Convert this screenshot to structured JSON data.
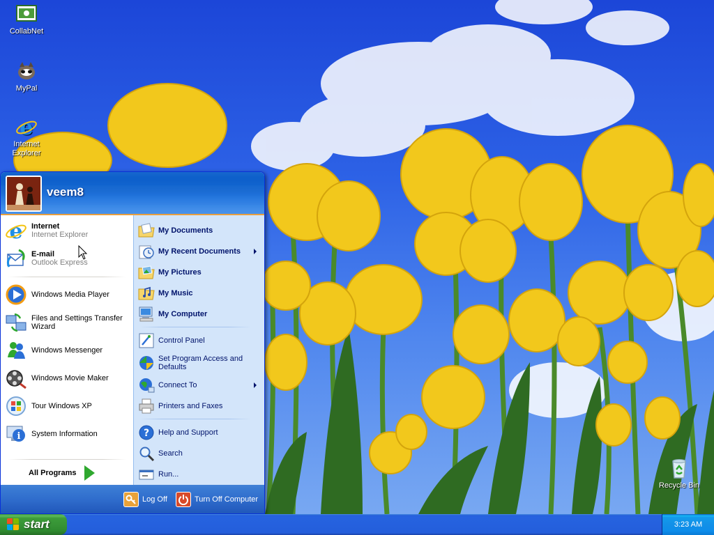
{
  "desktop": {
    "icons": [
      {
        "label": "CollabNet",
        "icon": "collabnet-icon"
      },
      {
        "label": "MyPal",
        "icon": "mypal-icon"
      },
      {
        "label": "Internet Explorer",
        "icon": "internet-explorer-icon"
      },
      {
        "label": "Recycle Bin",
        "icon": "recycle-bin-icon"
      }
    ]
  },
  "start_menu": {
    "user": "veem8",
    "left": {
      "pinned": [
        {
          "title": "Internet",
          "subtitle": "Internet Explorer",
          "icon": "internet-explorer-icon"
        },
        {
          "title": "E-mail",
          "subtitle": "Outlook Express",
          "icon": "outlook-express-icon"
        }
      ],
      "recent": [
        {
          "label": "Windows Media Player",
          "icon": "media-player-icon"
        },
        {
          "label": "Files and Settings Transfer Wizard",
          "icon": "transfer-wizard-icon"
        },
        {
          "label": "Windows Messenger",
          "icon": "messenger-icon"
        },
        {
          "label": "Windows Movie Maker",
          "icon": "movie-maker-icon"
        },
        {
          "label": "Tour Windows XP",
          "icon": "tour-xp-icon"
        },
        {
          "label": "System Information",
          "icon": "system-info-icon"
        }
      ],
      "all_programs": "All Programs"
    },
    "right": {
      "places": [
        {
          "label": "My Documents",
          "icon": "folder-icon"
        },
        {
          "label": "My Recent Documents",
          "icon": "recent-docs-icon"
        },
        {
          "label": "My Pictures",
          "icon": "pictures-folder-icon"
        },
        {
          "label": "My Music",
          "icon": "music-folder-icon"
        },
        {
          "label": "My Computer",
          "icon": "computer-icon"
        }
      ],
      "settings": [
        {
          "label": "Control Panel",
          "icon": "control-panel-icon"
        },
        {
          "label": "Set Program Access and Defaults",
          "icon": "program-access-icon"
        },
        {
          "label": "Connect To",
          "icon": "connect-to-icon"
        },
        {
          "label": "Printers and Faxes",
          "icon": "printer-icon"
        }
      ],
      "help": [
        {
          "label": "Help and Support",
          "icon": "help-icon"
        },
        {
          "label": "Search",
          "icon": "search-icon"
        },
        {
          "label": "Run...",
          "icon": "run-icon"
        }
      ]
    },
    "footer": {
      "log_off": "Log Off",
      "turn_off": "Turn Off Computer"
    }
  },
  "taskbar": {
    "start_label": "start",
    "clock": "3:23 AM"
  },
  "colors": {
    "xp_blue": "#245edb",
    "start_green": "#379436",
    "right_pane": "#d3e5fa",
    "orange_line": "#e89f3f"
  }
}
